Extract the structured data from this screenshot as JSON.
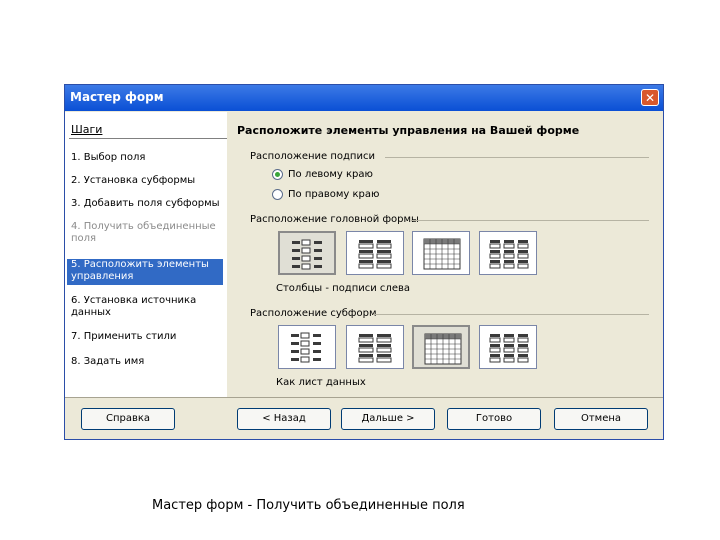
{
  "window": {
    "title": "Мастер форм",
    "close_icon": "✕"
  },
  "steps": {
    "title": "Шаги",
    "items": [
      {
        "label": "1. Выбор поля",
        "state": "normal"
      },
      {
        "label": "2. Установка субформы",
        "state": "normal"
      },
      {
        "label": "3. Добавить поля субформы",
        "state": "normal"
      },
      {
        "label": "4. Получить объединенные поля",
        "state": "disabled"
      },
      {
        "label": "5. Расположить элементы управления",
        "state": "active"
      },
      {
        "label": "6. Установка источника данных",
        "state": "normal"
      },
      {
        "label": "7. Применить стили",
        "state": "normal"
      },
      {
        "label": "8. Задать имя",
        "state": "normal"
      }
    ]
  },
  "main": {
    "heading": "Расположите элементы управления на Вашей форме",
    "label_placement": {
      "group_label": "Расположение подписи",
      "options": [
        {
          "label": "По левому краю",
          "checked": true
        },
        {
          "label": "По правому краю",
          "checked": false
        }
      ]
    },
    "main_form": {
      "group_label": "Расположение головной формы",
      "caption": "Столбцы - подписи слева",
      "layouts": [
        "columnar-left-labels",
        "columnar-top-labels",
        "data-sheet",
        "blocks-top-labels"
      ],
      "selected_index": 0
    },
    "subform": {
      "group_label": "Расположение субформ",
      "caption": "Как лист данных",
      "layouts": [
        "columnar-left-labels",
        "columnar-top-labels",
        "data-sheet",
        "blocks-top-labels"
      ],
      "selected_index": 2
    }
  },
  "buttons": {
    "help": "Справка",
    "back": "< Назад",
    "next": "Дальше >",
    "finish": "Готово",
    "cancel": "Отмена"
  },
  "page_caption": "Мастер форм - Получить объединенные поля",
  "colors": {
    "titlebar": "#0a4fd5",
    "selection": "#316ac5",
    "dialog_bg": "#ece9d8"
  }
}
